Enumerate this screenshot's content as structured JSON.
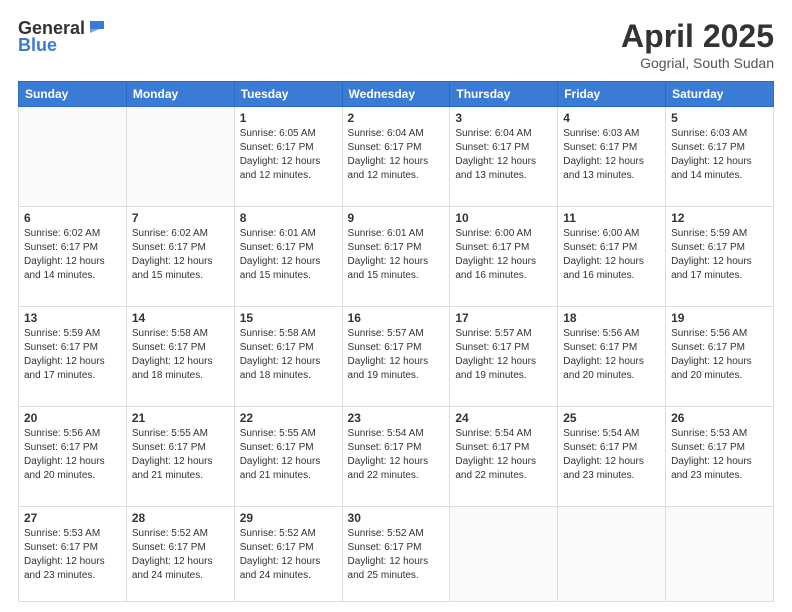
{
  "header": {
    "logo_general": "General",
    "logo_blue": "Blue",
    "title": "April 2025",
    "location": "Gogrial, South Sudan"
  },
  "weekdays": [
    "Sunday",
    "Monday",
    "Tuesday",
    "Wednesday",
    "Thursday",
    "Friday",
    "Saturday"
  ],
  "weeks": [
    [
      {
        "day": "",
        "info": ""
      },
      {
        "day": "",
        "info": ""
      },
      {
        "day": "1",
        "info": "Sunrise: 6:05 AM\nSunset: 6:17 PM\nDaylight: 12 hours\nand 12 minutes."
      },
      {
        "day": "2",
        "info": "Sunrise: 6:04 AM\nSunset: 6:17 PM\nDaylight: 12 hours\nand 12 minutes."
      },
      {
        "day": "3",
        "info": "Sunrise: 6:04 AM\nSunset: 6:17 PM\nDaylight: 12 hours\nand 13 minutes."
      },
      {
        "day": "4",
        "info": "Sunrise: 6:03 AM\nSunset: 6:17 PM\nDaylight: 12 hours\nand 13 minutes."
      },
      {
        "day": "5",
        "info": "Sunrise: 6:03 AM\nSunset: 6:17 PM\nDaylight: 12 hours\nand 14 minutes."
      }
    ],
    [
      {
        "day": "6",
        "info": "Sunrise: 6:02 AM\nSunset: 6:17 PM\nDaylight: 12 hours\nand 14 minutes."
      },
      {
        "day": "7",
        "info": "Sunrise: 6:02 AM\nSunset: 6:17 PM\nDaylight: 12 hours\nand 15 minutes."
      },
      {
        "day": "8",
        "info": "Sunrise: 6:01 AM\nSunset: 6:17 PM\nDaylight: 12 hours\nand 15 minutes."
      },
      {
        "day": "9",
        "info": "Sunrise: 6:01 AM\nSunset: 6:17 PM\nDaylight: 12 hours\nand 15 minutes."
      },
      {
        "day": "10",
        "info": "Sunrise: 6:00 AM\nSunset: 6:17 PM\nDaylight: 12 hours\nand 16 minutes."
      },
      {
        "day": "11",
        "info": "Sunrise: 6:00 AM\nSunset: 6:17 PM\nDaylight: 12 hours\nand 16 minutes."
      },
      {
        "day": "12",
        "info": "Sunrise: 5:59 AM\nSunset: 6:17 PM\nDaylight: 12 hours\nand 17 minutes."
      }
    ],
    [
      {
        "day": "13",
        "info": "Sunrise: 5:59 AM\nSunset: 6:17 PM\nDaylight: 12 hours\nand 17 minutes."
      },
      {
        "day": "14",
        "info": "Sunrise: 5:58 AM\nSunset: 6:17 PM\nDaylight: 12 hours\nand 18 minutes."
      },
      {
        "day": "15",
        "info": "Sunrise: 5:58 AM\nSunset: 6:17 PM\nDaylight: 12 hours\nand 18 minutes."
      },
      {
        "day": "16",
        "info": "Sunrise: 5:57 AM\nSunset: 6:17 PM\nDaylight: 12 hours\nand 19 minutes."
      },
      {
        "day": "17",
        "info": "Sunrise: 5:57 AM\nSunset: 6:17 PM\nDaylight: 12 hours\nand 19 minutes."
      },
      {
        "day": "18",
        "info": "Sunrise: 5:56 AM\nSunset: 6:17 PM\nDaylight: 12 hours\nand 20 minutes."
      },
      {
        "day": "19",
        "info": "Sunrise: 5:56 AM\nSunset: 6:17 PM\nDaylight: 12 hours\nand 20 minutes."
      }
    ],
    [
      {
        "day": "20",
        "info": "Sunrise: 5:56 AM\nSunset: 6:17 PM\nDaylight: 12 hours\nand 20 minutes."
      },
      {
        "day": "21",
        "info": "Sunrise: 5:55 AM\nSunset: 6:17 PM\nDaylight: 12 hours\nand 21 minutes."
      },
      {
        "day": "22",
        "info": "Sunrise: 5:55 AM\nSunset: 6:17 PM\nDaylight: 12 hours\nand 21 minutes."
      },
      {
        "day": "23",
        "info": "Sunrise: 5:54 AM\nSunset: 6:17 PM\nDaylight: 12 hours\nand 22 minutes."
      },
      {
        "day": "24",
        "info": "Sunrise: 5:54 AM\nSunset: 6:17 PM\nDaylight: 12 hours\nand 22 minutes."
      },
      {
        "day": "25",
        "info": "Sunrise: 5:54 AM\nSunset: 6:17 PM\nDaylight: 12 hours\nand 23 minutes."
      },
      {
        "day": "26",
        "info": "Sunrise: 5:53 AM\nSunset: 6:17 PM\nDaylight: 12 hours\nand 23 minutes."
      }
    ],
    [
      {
        "day": "27",
        "info": "Sunrise: 5:53 AM\nSunset: 6:17 PM\nDaylight: 12 hours\nand 23 minutes."
      },
      {
        "day": "28",
        "info": "Sunrise: 5:52 AM\nSunset: 6:17 PM\nDaylight: 12 hours\nand 24 minutes."
      },
      {
        "day": "29",
        "info": "Sunrise: 5:52 AM\nSunset: 6:17 PM\nDaylight: 12 hours\nand 24 minutes."
      },
      {
        "day": "30",
        "info": "Sunrise: 5:52 AM\nSunset: 6:17 PM\nDaylight: 12 hours\nand 25 minutes."
      },
      {
        "day": "",
        "info": ""
      },
      {
        "day": "",
        "info": ""
      },
      {
        "day": "",
        "info": ""
      }
    ]
  ]
}
